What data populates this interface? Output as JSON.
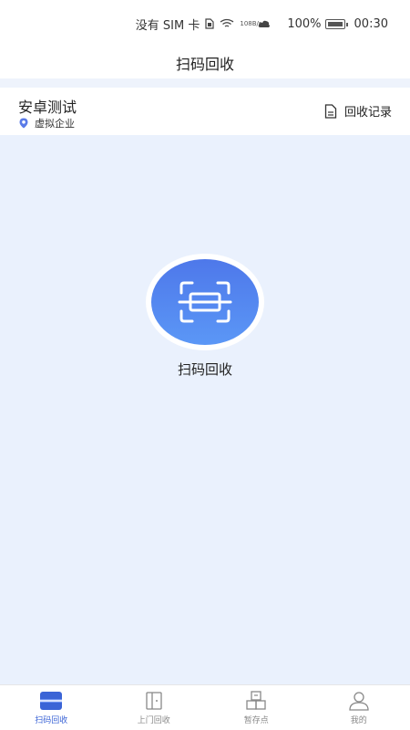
{
  "status_bar": {
    "carrier": "没有 SIM 卡",
    "speed_value": "108",
    "speed_unit": "B/s",
    "battery": "100%",
    "time": "00:30"
  },
  "title": "扫码回收",
  "company": {
    "name": "安卓测试",
    "type": "虚拟企业"
  },
  "records_link": "回收记录",
  "scan": {
    "label": "扫码回收"
  },
  "tabs": [
    {
      "label": "扫码回收",
      "icon": "scan-tab-icon",
      "active": true
    },
    {
      "label": "上门回收",
      "icon": "door-icon",
      "active": false
    },
    {
      "label": "暂存点",
      "icon": "storage-icon",
      "active": false
    },
    {
      "label": "我的",
      "icon": "user-icon",
      "active": false
    }
  ],
  "colors": {
    "accent": "#3b64d6",
    "scan_gradient_top": "#4e78ea",
    "scan_gradient_bottom": "#5b97f6",
    "background": "#eaf1fd"
  }
}
